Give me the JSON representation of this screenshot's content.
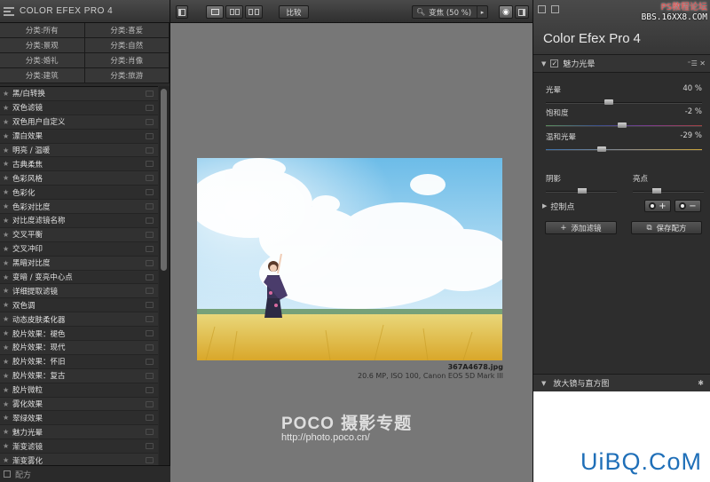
{
  "left": {
    "title": "COLOR EFEX PRO 4",
    "categories": [
      "分类:所有",
      "分类:喜爱",
      "分类:景观",
      "分类:自然",
      "分类:婚礼",
      "分类:肖像",
      "分类:建筑",
      "分类:旅游"
    ],
    "filters": [
      "黑/白转换",
      "双色滤镜",
      "双色用户自定义",
      "漂白效果",
      "明亮 / 温暖",
      "古典柔焦",
      "色彩风格",
      "色彩化",
      "色彩对比度",
      "对比度滤镜名称",
      "交叉平衡",
      "交叉冲印",
      "黑暗对比度",
      "变暗 / 变亮中心点",
      "详细提取滤镜",
      "双色调",
      "动态皮肤柔化器",
      "胶片效果：褪色",
      "胶片效果：现代",
      "胶片效果：怀旧",
      "胶片效果：复古",
      "胶片微粒",
      "雾化效果",
      "翠绿效果",
      "魅力光晕",
      "渐变滤镜",
      "渐变雾化"
    ],
    "footer": "配方"
  },
  "toolbar": {
    "compare": "比较",
    "zoom": "变焦 (50 %)"
  },
  "image": {
    "filename": "367A4678.jpg",
    "meta": "20.6 MP, ISO 100, Canon EOS 5D Mark III"
  },
  "watermark": {
    "brand": "POCO",
    "brand_suffix": "摄影专题",
    "url": "http://photo.poco.cn/"
  },
  "right": {
    "app_name": "Color Efex Pro",
    "app_version": "4",
    "ps_site": "PS教程论坛",
    "ps_url": "BBS.16XX8.COM",
    "filter_name": "魅力光晕",
    "sliders": [
      {
        "label": "光晕",
        "value": "40 %",
        "level": 0.4
      },
      {
        "label": "饱和度",
        "value": "-2 %",
        "level": 0.49
      },
      {
        "label": "温和光晕",
        "value": "-29 %",
        "level": 0.35
      }
    ],
    "shadows_label": "阴影",
    "highlights_label": "亮点",
    "control_points_label": "控制点",
    "add_filter": "添加滤镜",
    "save_recipe": "保存配方",
    "loupe_label": "放大镜与直方图",
    "site_mark": "UiBQ.CoM",
    "colors": {
      "accent_blue": "#1f6fb8",
      "ps_red": "#e65050"
    }
  }
}
